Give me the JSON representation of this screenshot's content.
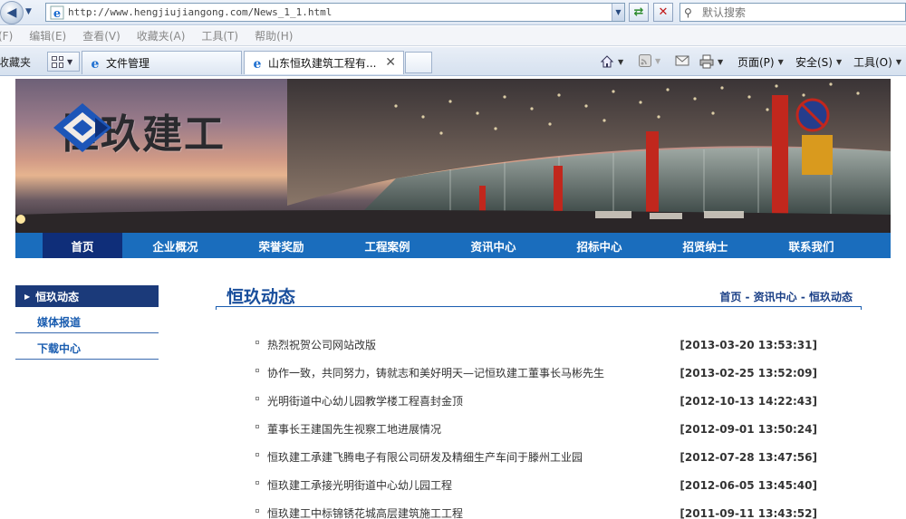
{
  "browser": {
    "url": "http://www.hengjiujiangong.com/News_1_1.html",
    "search_placeholder": "默认搜索",
    "menu": [
      "(F)",
      "编辑(E)",
      "查看(V)",
      "收藏夹(A)",
      "工具(T)",
      "帮助(H)"
    ],
    "favorites_label": "收藏夹",
    "tabs": [
      {
        "label": "文件管理"
      },
      {
        "label": "山东恒玖建筑工程有..."
      }
    ],
    "commands": {
      "page": "页面(P)",
      "safety": "安全(S)",
      "tools": "工具(O)"
    }
  },
  "site": {
    "logo_text": "恒玖建工",
    "nav": [
      "首页",
      "企业概况",
      "荣誉奖励",
      "工程案例",
      "资讯中心",
      "招标中心",
      "招贤纳士",
      "联系我们"
    ],
    "sidebar": {
      "active": "恒玖动态",
      "items": [
        "媒体报道",
        "下载中心"
      ]
    },
    "content": {
      "title": "恒玖动态",
      "breadcrumb": "首页 - 资讯中心 - 恒玖动态"
    },
    "news": [
      {
        "title": "热烈祝贺公司网站改版",
        "date": "[2013-03-20 13:53:31]"
      },
      {
        "title": "协作一致，共同努力，铸就志和美好明天—记恒玖建工董事长马彬先生",
        "date": "[2013-02-25 13:52:09]"
      },
      {
        "title": "光明街道中心幼儿园教学楼工程喜封金顶",
        "date": "[2012-10-13 14:22:43]"
      },
      {
        "title": "董事长王建国先生视察工地进展情况",
        "date": "[2012-09-01 13:50:24]"
      },
      {
        "title": "恒玖建工承建飞腾电子有限公司研发及精细生产车间于滕州工业园",
        "date": "[2012-07-28 13:47:56]"
      },
      {
        "title": "恒玖建工承接光明街道中心幼儿园工程",
        "date": "[2012-06-05 13:45:40]"
      },
      {
        "title": "恒玖建工中标锦锈花城高层建筑施工工程",
        "date": "[2011-09-11 13:43:52]"
      }
    ]
  },
  "colors": {
    "nav_blue": "#1a6dbd",
    "nav_active": "#0f2e79",
    "title_blue": "#1a4f9c"
  }
}
